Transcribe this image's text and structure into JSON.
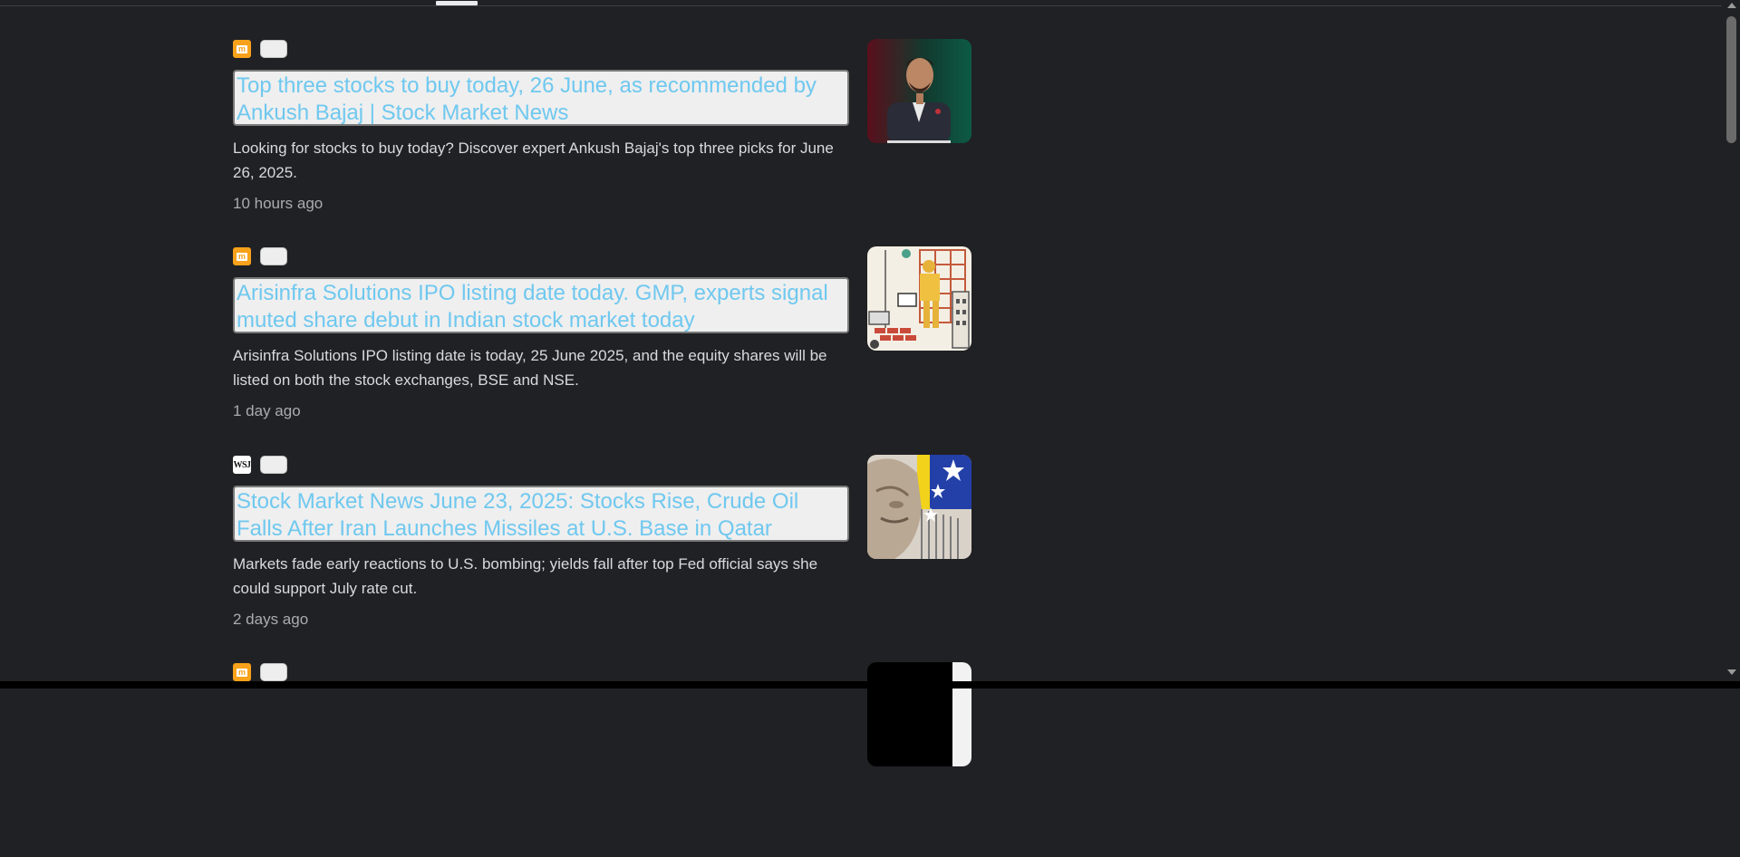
{
  "articles": [
    {
      "source_icon": "mint-logo",
      "logo_text": "m",
      "headline": "Top three stocks to buy today, 26 June, as recommended by Ankush Bajaj | Stock Market News",
      "snippet": "Looking for stocks to buy today? Discover expert Ankush Bajaj's top three picks for June 26, 2025.",
      "time": "10 hours ago"
    },
    {
      "source_icon": "mint-logo",
      "logo_text": "m",
      "headline": "Arisinfra Solutions IPO listing date today. GMP, experts signal muted share debut in Indian stock market today",
      "snippet": "Arisinfra Solutions IPO listing date is today, 25 June 2025, and the equity shares will be listed on both the stock exchanges, BSE and NSE.",
      "time": "1 day ago"
    },
    {
      "source_icon": "wsj-logo",
      "logo_text": "WSJ",
      "headline": "Stock Market News June 23, 2025: Stocks Rise, Crude Oil Falls After Iran Launches Missiles at U.S. Base in Qatar",
      "snippet": "Markets fade early reactions to U.S. bombing; yields fall after top Fed official says she could support July rate cut.",
      "time": "2 days ago"
    },
    {
      "source_icon": "mint-logo",
      "logo_text": "m"
    }
  ]
}
